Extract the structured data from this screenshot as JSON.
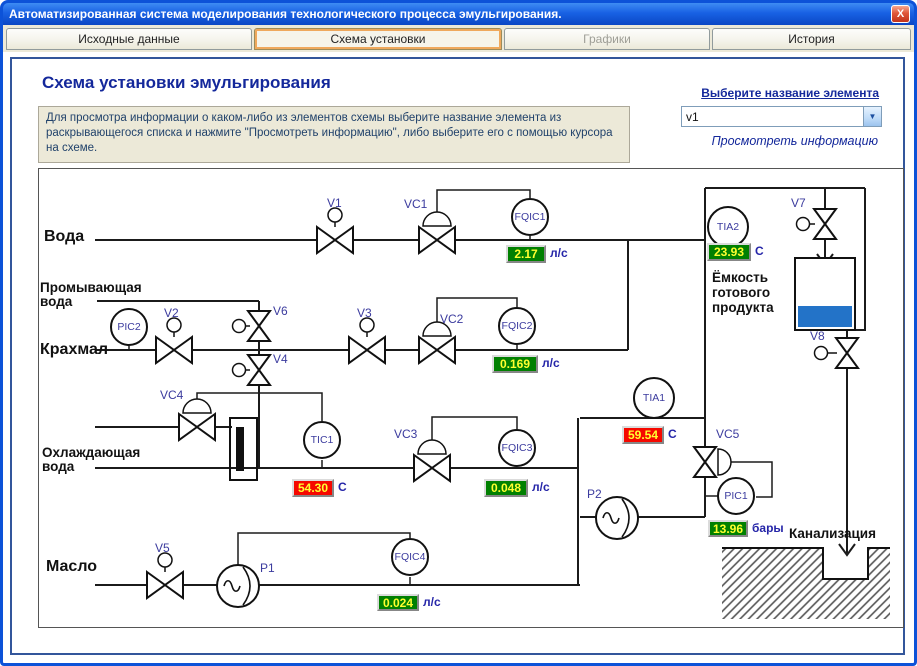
{
  "window": {
    "title": "Автоматизированная система моделирования технологического процесса эмульгирования.",
    "close_glyph": "X"
  },
  "tabs": [
    {
      "label": "Исходные данные"
    },
    {
      "label": "Схема установки"
    },
    {
      "label": "Графики"
    },
    {
      "label": "История"
    }
  ],
  "header": {
    "title": "Схема установки эмульгирования",
    "select_label": "Выберите название элемента",
    "select_value": "v1",
    "dropdown_arrow": "▼",
    "view_info_link": "Просмотреть информацию",
    "instructions": "Для просмотра информации о каком-либо из элементов схемы выберите название элемента из раскрывающегося списка и нажмите \"Просмотреть информацию\", либо выберите его с помощью курсора на схеме."
  },
  "diagram": {
    "streams": {
      "water": "Вода",
      "washing1": "Промывающая",
      "washing2": "вода",
      "starch": "Крахмал",
      "cooling1": "Охлаждающая",
      "cooling2": "вода",
      "oil": "Масло"
    },
    "tank_label": {
      "l1": "Ёмкость",
      "l2": "готового",
      "l3": "продукта"
    },
    "sewer_label": "Канализация",
    "valves": {
      "v1": "V1",
      "v2": "V2",
      "v3": "V3",
      "v4": "V4",
      "v5": "V5",
      "v6": "V6",
      "v7": "V7",
      "v8": "V8",
      "vc1": "VC1",
      "vc2": "VC2",
      "vc3": "VC3",
      "vc4": "VC4",
      "vc5": "VC5"
    },
    "pumps": {
      "p1": "P1",
      "p2": "P2"
    },
    "instruments": {
      "pic2": {
        "label": "PIC2"
      },
      "fqic1": {
        "label": "FQIC1",
        "value": "2.17",
        "unit": "л/с",
        "status": "green"
      },
      "fqic2": {
        "label": "FQIC2",
        "value": "0.169",
        "unit": "л/с",
        "status": "green"
      },
      "fqic3": {
        "label": "FQIC3",
        "value": "0.048",
        "unit": "л/с",
        "status": "green"
      },
      "fqic4": {
        "label": "FQIC4",
        "value": "0.024",
        "unit": "л/с",
        "status": "green"
      },
      "tic1": {
        "label": "TIC1",
        "value": "54.30",
        "unit": "C",
        "status": "red"
      },
      "tia1": {
        "label": "TIA1",
        "value": "59.54",
        "unit": "C",
        "status": "red"
      },
      "tia2": {
        "label": "TIA2",
        "value": "23.93",
        "unit": "C",
        "status": "green"
      },
      "pic1": {
        "label": "PIC1",
        "value": "13.96",
        "unit": "бары",
        "status": "green"
      }
    },
    "colors": {
      "value_ok_bg": "#018001",
      "value_alarm_bg": "#F50800",
      "value_text": "#FFFF30",
      "tank_liquid": "#2373C8",
      "accent_navy": "#14289B"
    }
  }
}
